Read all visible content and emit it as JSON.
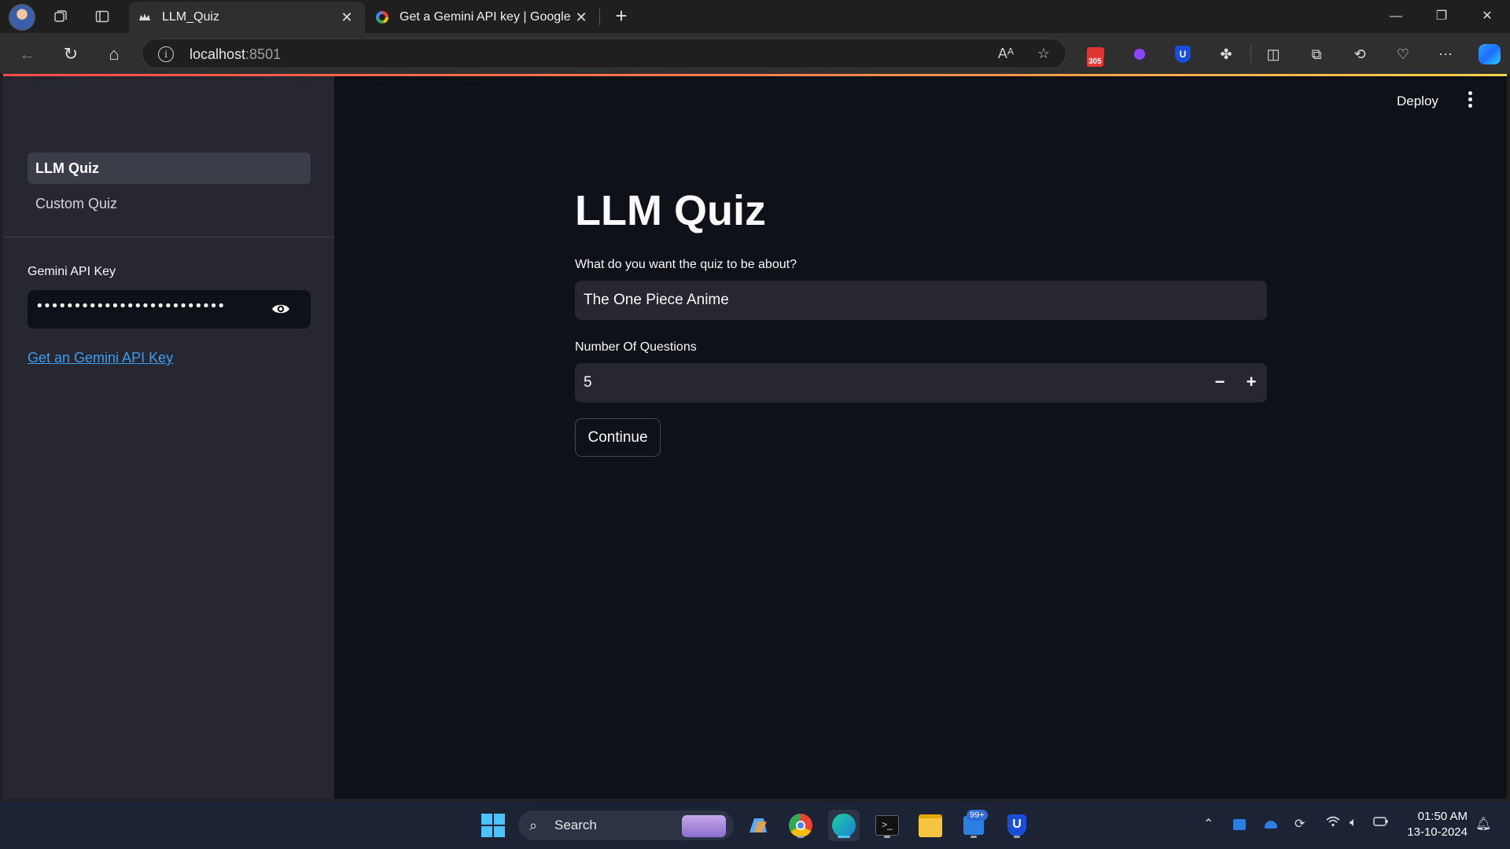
{
  "browser": {
    "tabs": [
      {
        "title": "LLM_Quiz",
        "active": true
      },
      {
        "title": "Get a Gemini API key  |  Google AI",
        "active": false
      }
    ],
    "url_host": "localhost",
    "url_port": ":8501",
    "gmail_badge": "305"
  },
  "sidebar": {
    "nav": [
      {
        "label": "LLM Quiz",
        "active": true
      },
      {
        "label": "Custom Quiz",
        "active": false
      }
    ],
    "api_key_label": "Gemini API Key",
    "api_key_masked": "••••••••••••••••••••••••••••••••••••••",
    "api_link": "Get an Gemini API Key"
  },
  "header": {
    "deploy_label": "Deploy"
  },
  "main": {
    "title": "LLM Quiz",
    "topic_label": "What do you want the quiz to be about?",
    "topic_value": "The One Piece Anime",
    "count_label": "Number Of Questions",
    "count_value": "5",
    "continue_label": "Continue"
  },
  "taskbar": {
    "search_label": "Search",
    "badge": "99+",
    "time": "01:50 AM",
    "date": "13-10-2024"
  },
  "colors": {
    "accent": "#ff4b4b",
    "link": "#3d9df3",
    "sidebar_bg": "#262730",
    "main_bg": "#0e1117"
  }
}
